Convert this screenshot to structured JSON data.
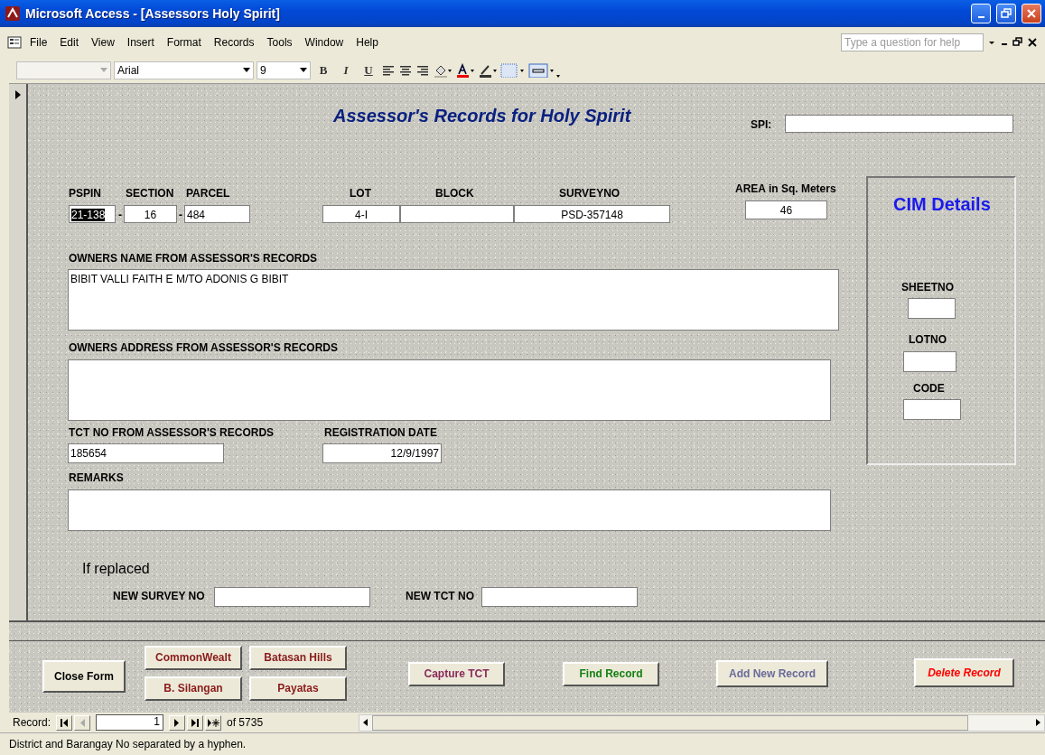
{
  "window": {
    "title": "Microsoft Access - [Assessors Holy Spirit]"
  },
  "menu": [
    "File",
    "Edit",
    "View",
    "Insert",
    "Format",
    "Records",
    "Tools",
    "Window",
    "Help"
  ],
  "help_box": {
    "placeholder": "Type a question for help"
  },
  "toolbar": {
    "font": "Arial",
    "size": "9",
    "bold": "B",
    "italic": "I",
    "underline": "U"
  },
  "form": {
    "title": "Assessor's Records for Holy Spirit",
    "cim_title": "CIM Details",
    "replaced_title": "If replaced",
    "labels": [
      "SPI:",
      "PSPIN",
      "SECTION",
      "PARCEL",
      "LOT",
      "BLOCK",
      "SURVEYNO",
      "AREA in Sq. Meters",
      "SHEETNO",
      "LOTNO",
      "CODE",
      "OWNERS NAME FROM ASSESSOR'S RECORDS",
      "OWNERS ADDRESS FROM ASSESSOR'S RECORDS",
      "TCT NO  FROM ASSESSOR'S RECORDS",
      "REGISTRATION DATE",
      "REMARKS",
      "NEW SURVEY NO",
      "NEW TCT NO",
      "-",
      "-"
    ],
    "fields": [
      {
        "kind": "empty"
      },
      {
        "kind": "text",
        "value": "21-138",
        "selected": true
      },
      {
        "kind": "text",
        "value": "16",
        "selected": false
      },
      {
        "kind": "text",
        "value": "484",
        "selected": false
      },
      {
        "kind": "text",
        "value": "4-I",
        "selected": false
      },
      {
        "kind": "empty"
      },
      {
        "kind": "text",
        "value": "PSD-357148",
        "selected": false
      },
      {
        "kind": "text",
        "value": "46",
        "selected": false
      },
      {
        "kind": "text",
        "value": "BIBIT VALLI FAITH E M/TO ADONIS G BIBIT",
        "selected": false
      },
      {
        "kind": "empty"
      },
      {
        "kind": "text",
        "value": "185654",
        "selected": false
      },
      {
        "kind": "text",
        "value": "12/9/1997",
        "selected": false
      },
      {
        "kind": "empty"
      },
      {
        "kind": "empty"
      },
      {
        "kind": "empty"
      },
      {
        "kind": "empty"
      },
      {
        "kind": "empty"
      },
      {
        "kind": "empty"
      }
    ]
  },
  "buttons": [
    {
      "label": "Close Form",
      "color": "#000000",
      "italic": false
    },
    {
      "label": "CommonWealt",
      "color": "#8b1a1a",
      "italic": false
    },
    {
      "label": "Batasan Hills",
      "color": "#8b1a1a",
      "italic": false
    },
    {
      "label": "B. Silangan",
      "color": "#8b1a1a",
      "italic": false
    },
    {
      "label": "Payatas",
      "color": "#8b1a1a",
      "italic": false
    },
    {
      "label": "Capture TCT",
      "color": "#8b2a5a",
      "italic": false
    },
    {
      "label": "Find Record",
      "color": "#138013",
      "italic": false
    },
    {
      "label": "Add New Record",
      "color": "#6a6a9a",
      "italic": false
    },
    {
      "label": "Delete Record",
      "color": "#ff0000",
      "italic": true
    }
  ],
  "navigation": {
    "label": "Record:",
    "current": "1",
    "total": "of 5735"
  },
  "status_bar": "District and Barangay No separated by a hyphen."
}
